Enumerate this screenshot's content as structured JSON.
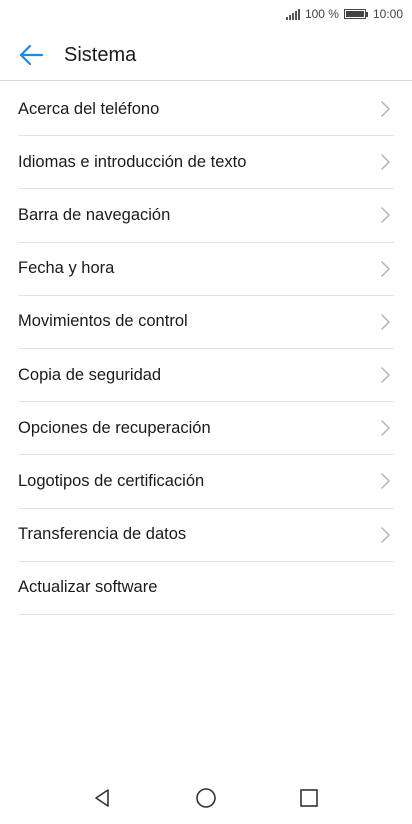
{
  "status_bar": {
    "battery_percent": "100 %",
    "time": "10:00",
    "icons": [
      "signal-icon",
      "battery-icon"
    ]
  },
  "header": {
    "title": "Sistema",
    "back_icon": "arrow-left-icon",
    "accent_color": "#1e88e5"
  },
  "settings": {
    "items": [
      {
        "label": "Acerca del teléfono",
        "chevron": true
      },
      {
        "label": "Idiomas e introducción de texto",
        "chevron": true
      },
      {
        "label": "Barra de navegación",
        "chevron": true
      },
      {
        "label": "Fecha y hora",
        "chevron": true
      },
      {
        "label": "Movimientos de control",
        "chevron": true
      },
      {
        "label": "Copia de seguridad",
        "chevron": true
      },
      {
        "label": "Opciones de recuperación",
        "chevron": true
      },
      {
        "label": "Logotipos de certificación",
        "chevron": true
      },
      {
        "label": "Transferencia de datos",
        "chevron": true
      },
      {
        "label": "Actualizar software",
        "chevron": false
      }
    ]
  },
  "nav_bar": {
    "buttons": [
      "back-triangle-icon",
      "home-circle-icon",
      "recents-square-icon"
    ]
  }
}
